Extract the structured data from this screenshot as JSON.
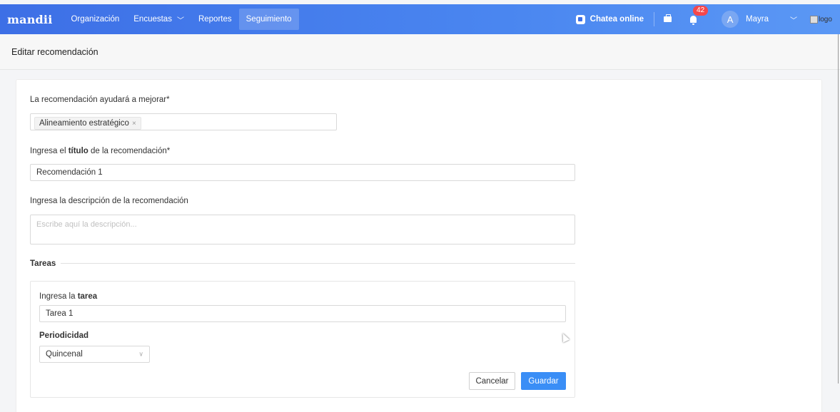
{
  "nav": {
    "brand": "mandii",
    "items": [
      {
        "label": "Organización",
        "dropdown": false,
        "active": false
      },
      {
        "label": "Encuestas",
        "dropdown": true,
        "active": false
      },
      {
        "label": "Reportes",
        "dropdown": false,
        "active": false
      },
      {
        "label": "Seguimiento",
        "dropdown": false,
        "active": true
      }
    ],
    "chat_label": "Chatea online",
    "notification_count": "42",
    "avatar_initial": "A",
    "user_name": "Mayra",
    "logo_alt": "logo",
    "accent_color": "#3d6fe6"
  },
  "page": {
    "title": "Editar recomendación"
  },
  "form": {
    "improve_label": "La recomendación ayudará a mejorar*",
    "improve_tag": "Alineamiento estratégico",
    "tag_remove": "×",
    "title_label_pre": "Ingresa el ",
    "title_label_bold": "título",
    "title_label_post": " de la recomendación*",
    "title_value": "Recomendación 1",
    "description_label": "Ingresa la descripción de la recomendación",
    "description_placeholder": "Escribe aquí la descripción...",
    "tasks_heading": "Tareas",
    "task": {
      "label_pre": "Ingresa la ",
      "label_bold": "tarea",
      "value": "Tarea 1",
      "periodicity_label": "Periodicidad",
      "periodicity_value": "Quincenal"
    },
    "cancel_label": "Cancelar",
    "save_label": "Guardar",
    "save_color": "#3a8ef6"
  }
}
